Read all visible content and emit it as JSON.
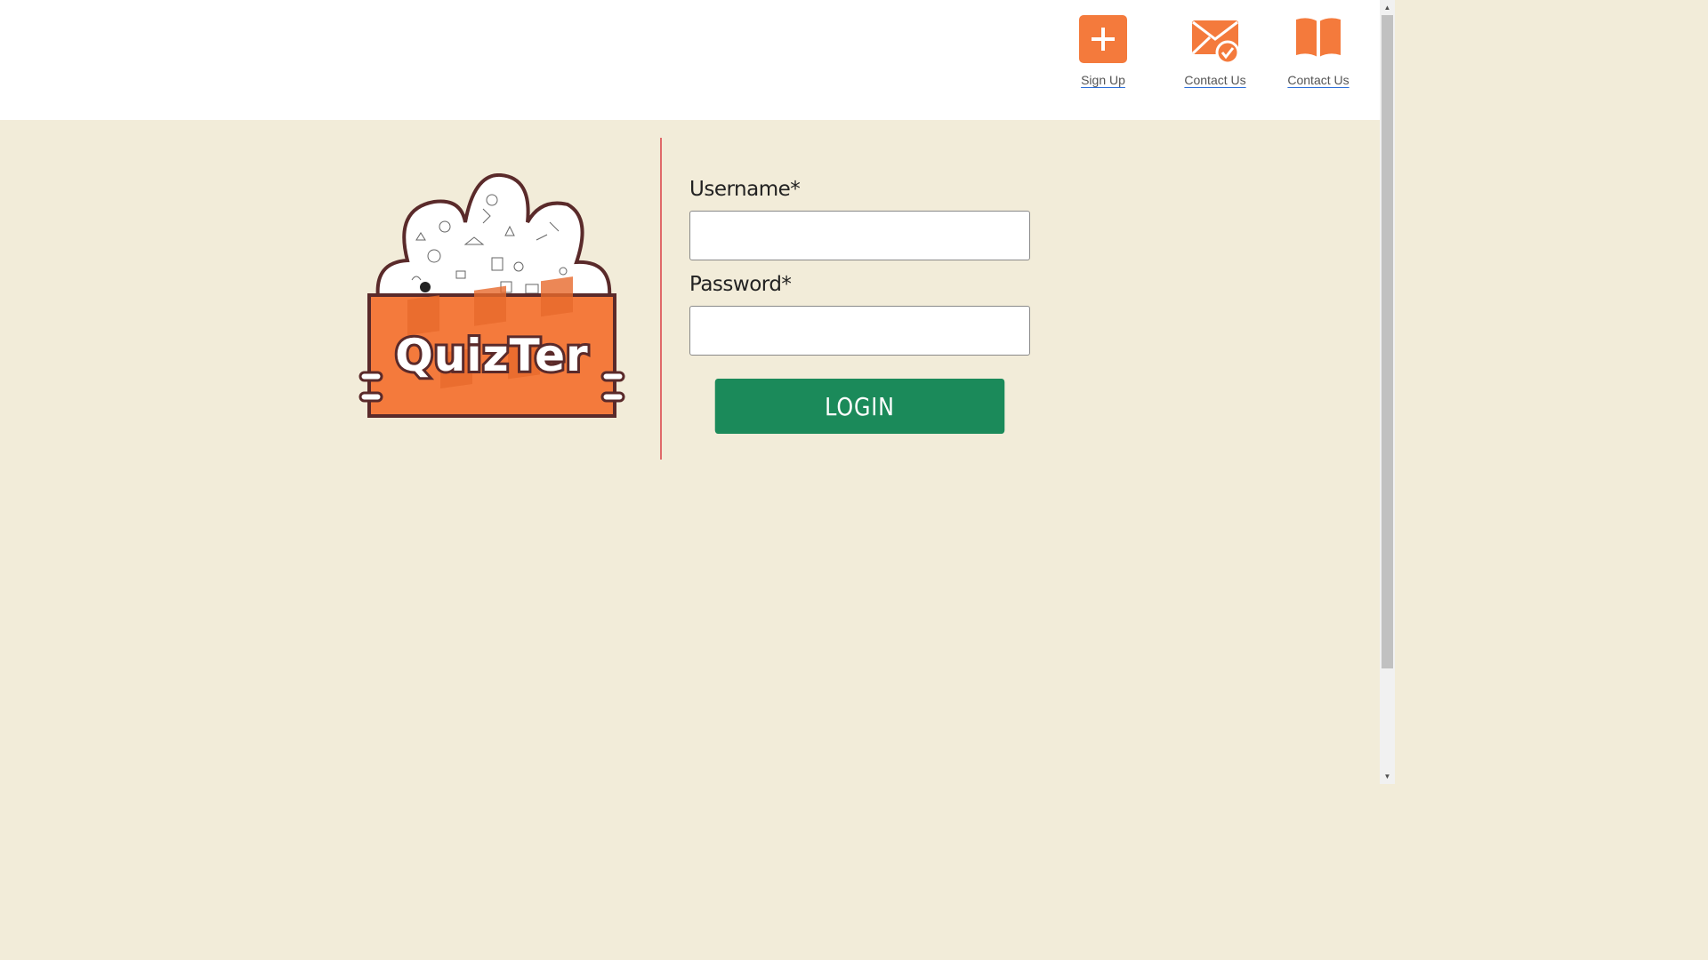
{
  "header": {
    "nav": [
      {
        "label": "Sign Up",
        "icon": "plus-icon"
      },
      {
        "label": "Contact Us",
        "icon": "mail-check-icon"
      },
      {
        "label": "Contact Us",
        "icon": "book-icon"
      }
    ]
  },
  "logo": {
    "text": "QuizTer"
  },
  "form": {
    "username_label": "Username*",
    "username_value": "",
    "password_label": "Password*",
    "password_value": "",
    "login_label": "LOGIN"
  },
  "colors": {
    "accent": "#f47a3c",
    "background": "#f2ecd9",
    "button": "#1b8a5a",
    "divider": "#e06a6a",
    "outline": "#5a2a2a"
  }
}
